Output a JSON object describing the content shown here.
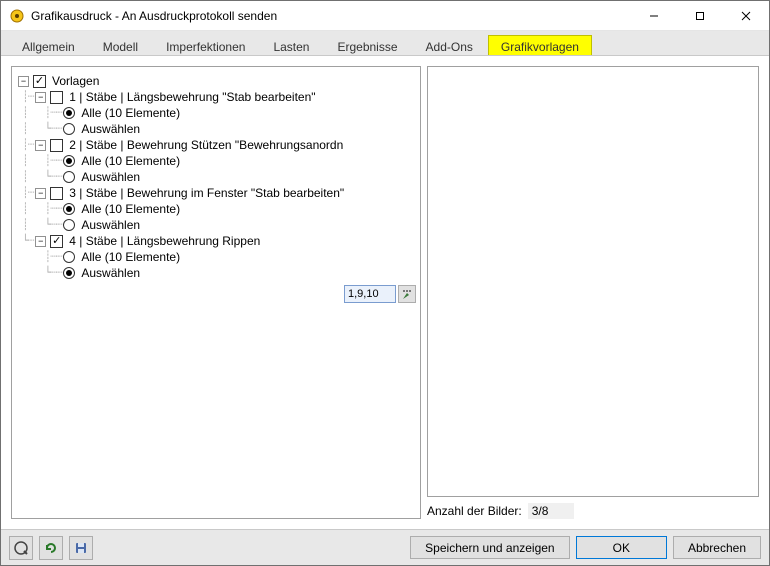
{
  "window": {
    "title": "Grafikausdruck - An Ausdruckprotokoll senden"
  },
  "tabs": {
    "t0": "Allgemein",
    "t1": "Modell",
    "t2": "Imperfektionen",
    "t3": "Lasten",
    "t4": "Ergebnisse",
    "t5": "Add-Ons",
    "t6": "Grafikvorlagen"
  },
  "tree": {
    "root": "Vorlagen",
    "n1": {
      "label": "1 | Stäbe | Längsbewehrung \"Stab bearbeiten\"",
      "alle": "Alle (10 Elemente)",
      "sel": "Auswählen"
    },
    "n2": {
      "label": "2 | Stäbe | Bewehrung Stützen \"Bewehrungsanordn",
      "alle": "Alle (10 Elemente)",
      "sel": "Auswählen"
    },
    "n3": {
      "label": "3 | Stäbe | Bewehrung im Fenster \"Stab bearbeiten\"",
      "alle": "Alle (10 Elemente)",
      "sel": "Auswählen"
    },
    "n4": {
      "label": "4 | Stäbe | Längsbewehrung Rippen",
      "alle": "Alle (10 Elemente)",
      "sel": "Auswählen"
    }
  },
  "selection_value": "1,9,10",
  "count": {
    "label": "Anzahl der Bilder:",
    "value": "3/8"
  },
  "buttons": {
    "save_show": "Speichern und anzeigen",
    "ok": "OK",
    "cancel": "Abbrechen"
  },
  "toggle_minus": "−",
  "check_mark": "✓"
}
